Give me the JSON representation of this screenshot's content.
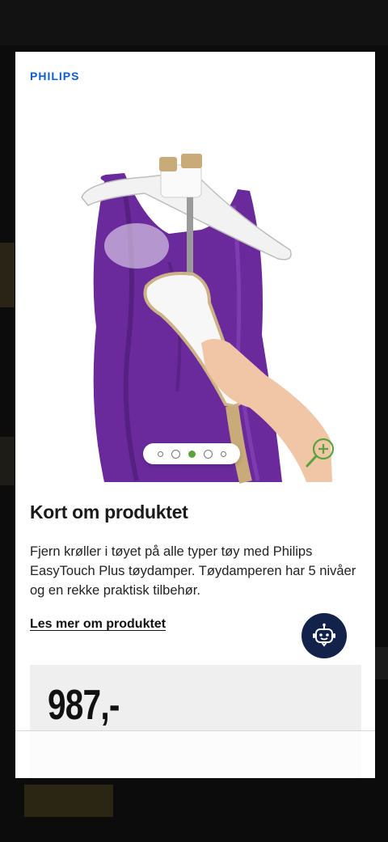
{
  "modal": {
    "brand": "PHILIPS",
    "image_alt_icon": "garment-steamer-product-image",
    "carousel": {
      "total": 5,
      "active": 3
    },
    "zoom_icon": "zoom-in-icon",
    "section_title": "Kort om produktet",
    "description": "Fjern krøller i tøyet på alle typer tøy med Philips EasyTouch Plus tøydamper. Tøydamperen har 5 nivåer og en rekke praktisk tilbehør.",
    "read_more_label": "Les mer om produktet",
    "assistant_icon": "chat-bot-icon",
    "price": "987,-"
  },
  "colors": {
    "brand": "#0b5ed7",
    "accent_green": "#58a33a",
    "bot_button": "#13224a",
    "dress": "#6a2a9c"
  }
}
